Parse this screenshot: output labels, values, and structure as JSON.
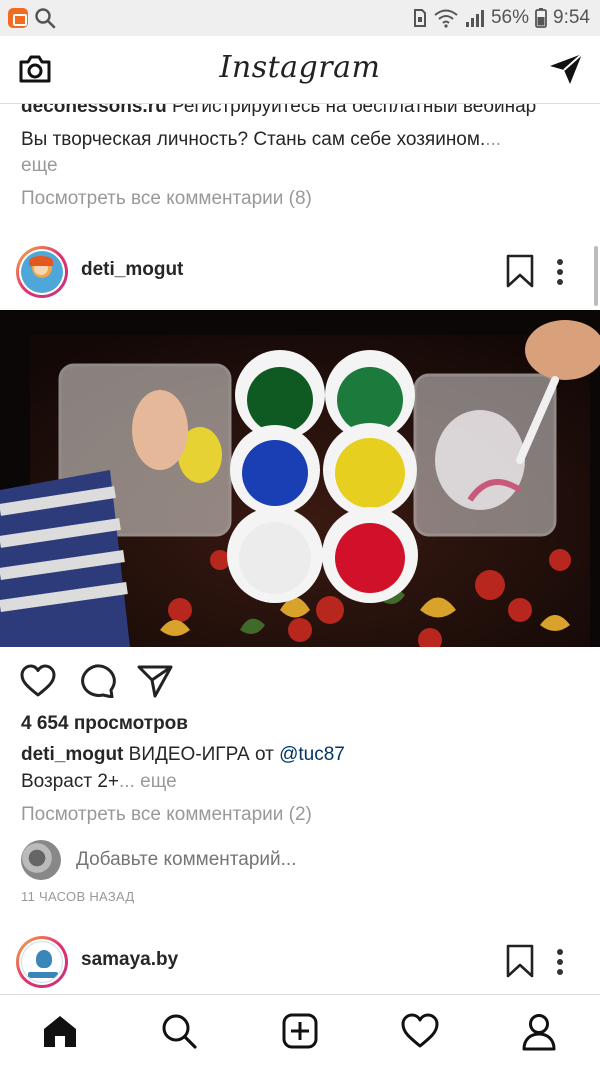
{
  "status_bar": {
    "battery": "56%",
    "time": "9:54"
  },
  "header": {
    "logo": "Instagram"
  },
  "previous_post": {
    "cut_link": "deconessons.ru",
    "cut_text": "Регистрируйтесь на бесплатный вебинар",
    "caption": "Вы творческая личность? Стань сам себе хозяином.",
    "caption_ellipsis": "...",
    "more": "еще",
    "view_comments": "Посмотреть все комментарии (8)"
  },
  "post": {
    "username": "deti_mogut",
    "views": "4 654 просмотров",
    "caption_user": "deti_mogut",
    "caption_text": " ВИДЕО-ИГРА от ",
    "caption_mention": "@tuc87",
    "caption_line2": "Возраст 2+",
    "caption_more": "... еще",
    "view_comments": "Посмотреть все комментарии (2)",
    "comment_placeholder": "Добавьте комментарий...",
    "timestamp": "11 ЧАСОВ НАЗАД"
  },
  "next_post": {
    "username": "samaya.by"
  },
  "colors": {
    "accent_link": "#003569",
    "muted_text": "#999999",
    "text": "#262626"
  }
}
